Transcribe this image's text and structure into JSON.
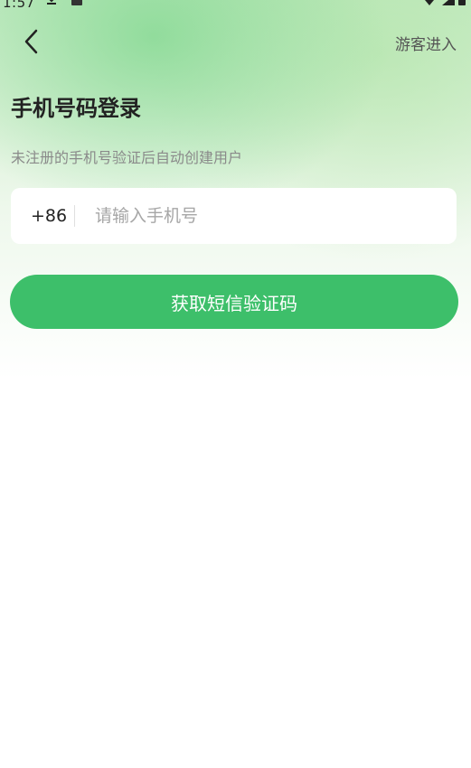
{
  "status_bar": {
    "time": "1:57"
  },
  "header": {
    "back_icon": "chevron-left-icon",
    "guest_label": "游客进入"
  },
  "login": {
    "title": "手机号码登录",
    "subtitle": "未注册的手机号验证后自动创建用户",
    "country_code": "+86",
    "phone_placeholder": "请输入手机号",
    "phone_value": "",
    "submit_label": "获取短信验证码"
  },
  "colors": {
    "accent": "#3dbf6a",
    "gradient_top": "#a6e0a8"
  }
}
